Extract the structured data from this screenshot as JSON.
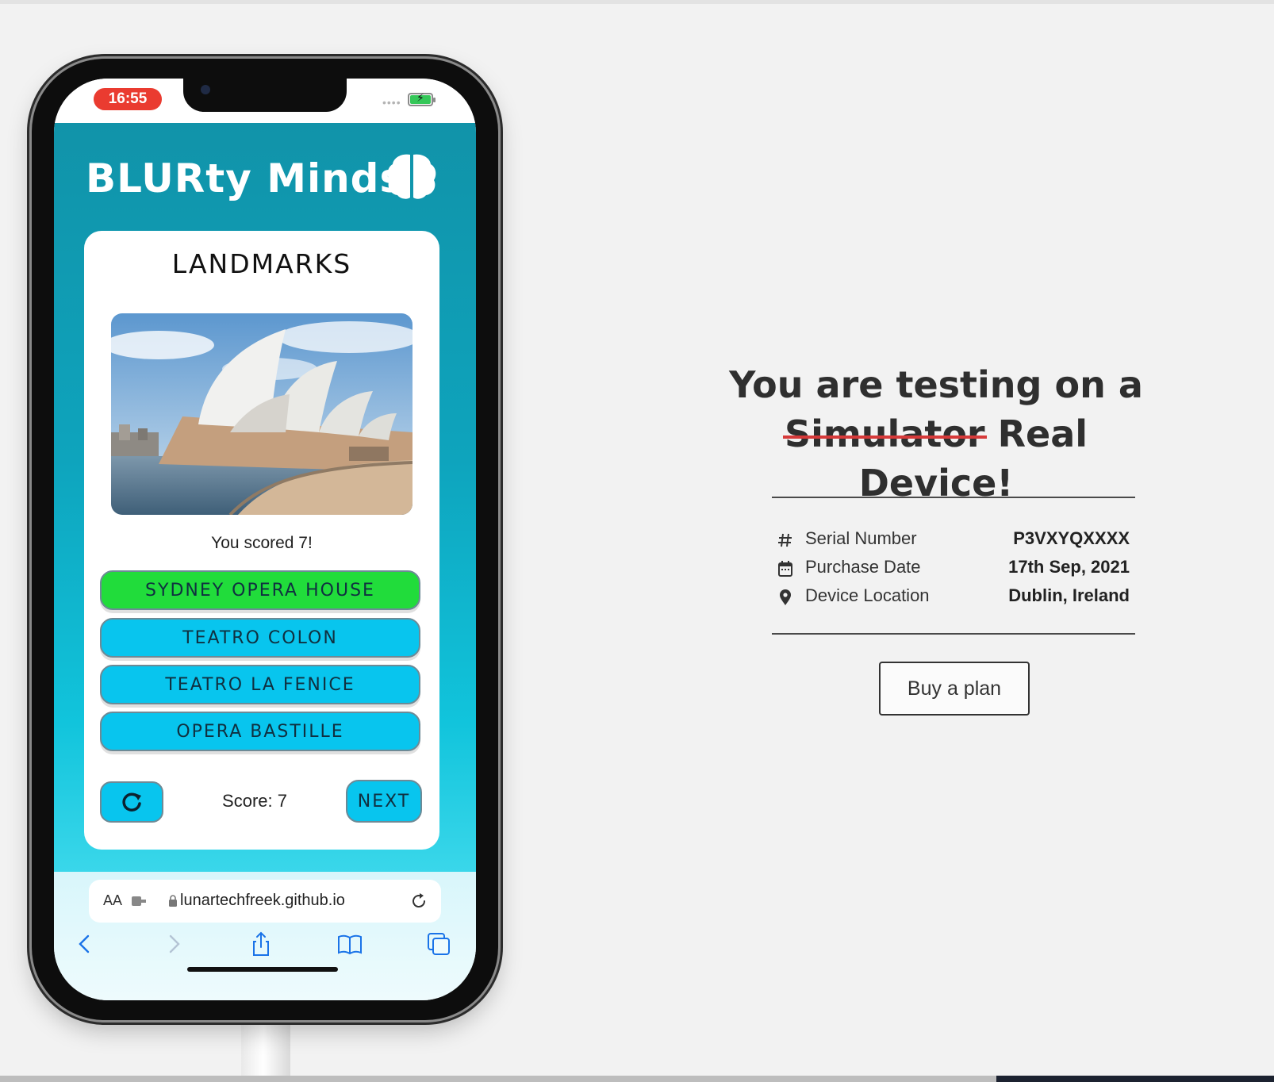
{
  "device": {
    "status_time": "16:55",
    "signal_dots": "••••"
  },
  "app": {
    "title": "BLURty Minds",
    "category": "LANDMARKS",
    "score_message": "You scored 7!",
    "answers": [
      {
        "label": "SYDNEY OPERA HOUSE",
        "state": "correct"
      },
      {
        "label": "TEATRO COLON",
        "state": "default"
      },
      {
        "label": "TEATRO LA FENICE",
        "state": "default"
      },
      {
        "label": "OPERA BASTILLE",
        "state": "default"
      }
    ],
    "score_label": "Score: 7",
    "next_label": "NEXT",
    "colors": {
      "header_bg": "#1193a9",
      "answer_default": "#08c5ee",
      "answer_correct": "#21dc3b"
    }
  },
  "browser": {
    "text_size_label": "AA",
    "url": "lunartechfreek.github.io",
    "icons": [
      "back-icon",
      "forward-icon",
      "share-icon",
      "bookmarks-icon",
      "tabs-icon"
    ]
  },
  "panel": {
    "headline_line1": "You are testing on a",
    "headline_struck": "Simulator",
    "headline_rest": "Real Device!",
    "strike_color": "#d63a3a",
    "rows": [
      {
        "icon": "hash-icon",
        "label": "Serial Number",
        "value": "P3VXYQXXXX"
      },
      {
        "icon": "calendar-icon",
        "label": "Purchase Date",
        "value": "17th Sep, 2021"
      },
      {
        "icon": "location-pin-icon",
        "label": "Device Location",
        "value": "Dublin, Ireland"
      }
    ],
    "buy_label": "Buy a plan"
  }
}
